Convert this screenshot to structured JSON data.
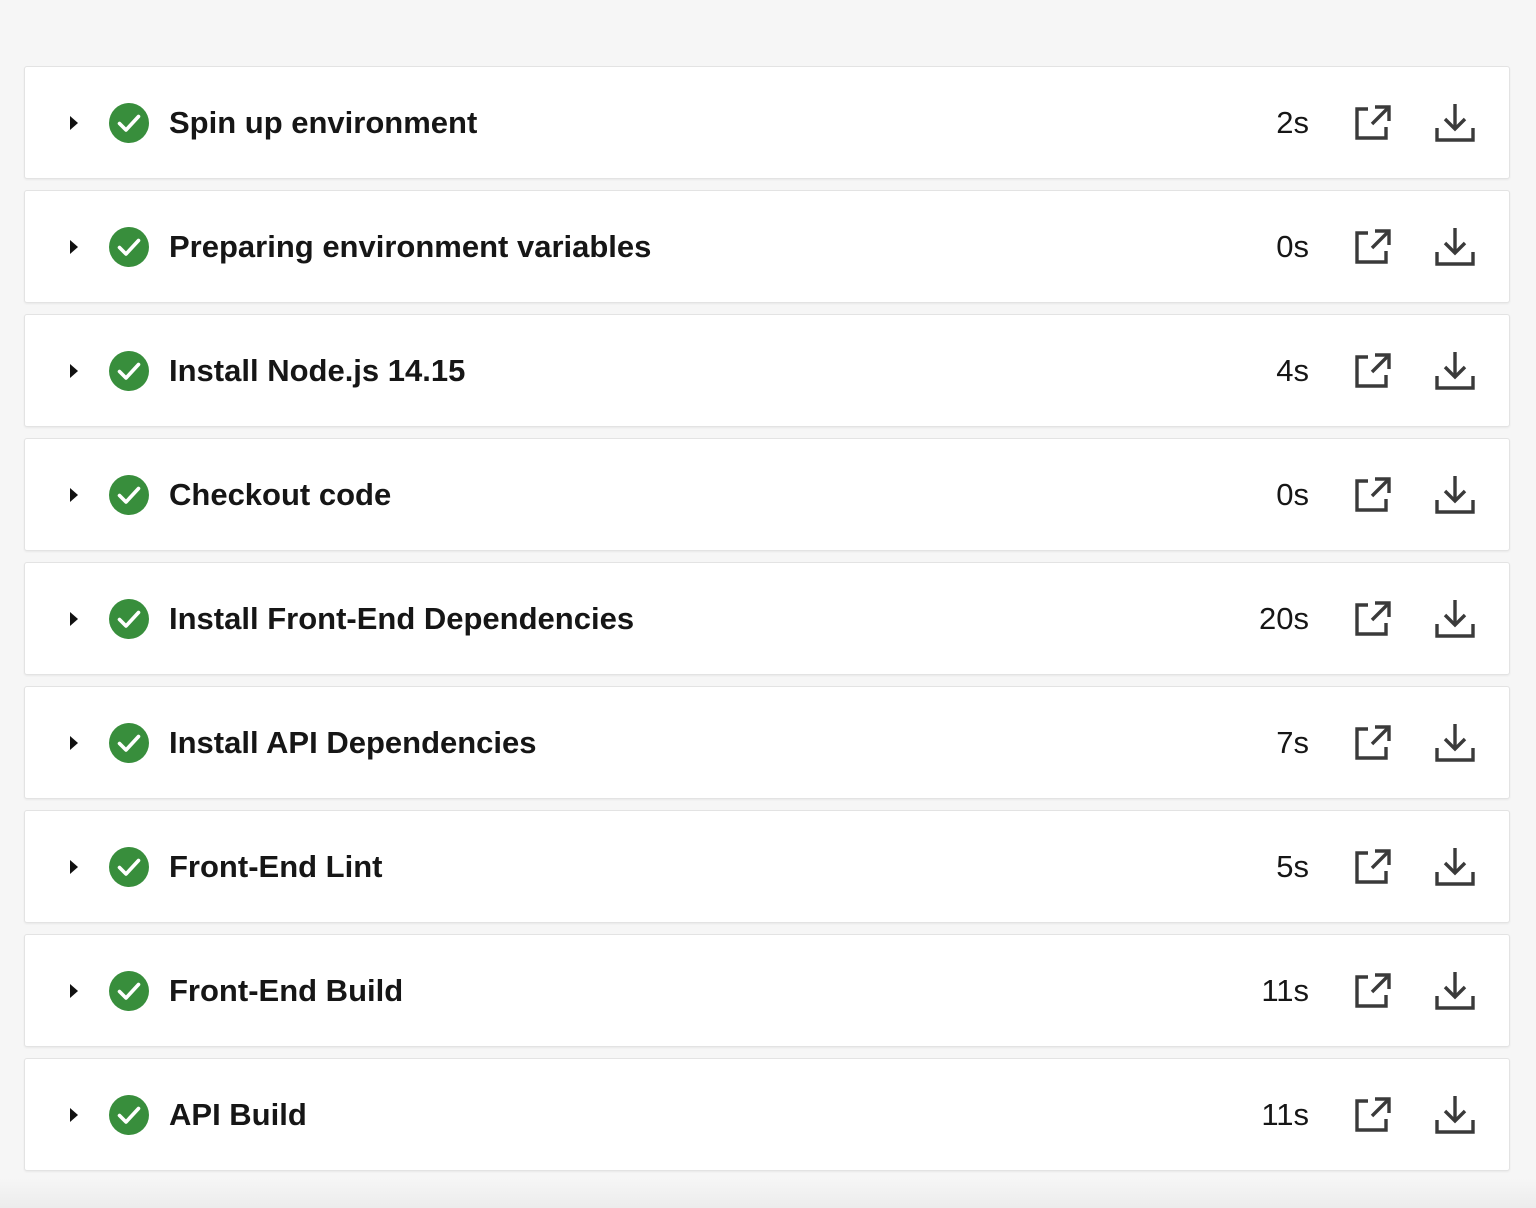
{
  "colors": {
    "success": "#388e3c",
    "text": "#161616",
    "icon": "#3a3a3a",
    "card_border": "#e3e3e3",
    "background": "#f6f6f6"
  },
  "icons": {
    "expand": "caret-right-icon",
    "status": "success-check-icon",
    "open": "external-link-icon",
    "download": "download-icon"
  },
  "steps": [
    {
      "name": "Spin up environment",
      "duration": "2s"
    },
    {
      "name": "Preparing environment variables",
      "duration": "0s"
    },
    {
      "name": "Install Node.js 14.15",
      "duration": "4s"
    },
    {
      "name": "Checkout code",
      "duration": "0s"
    },
    {
      "name": "Install Front-End Dependencies",
      "duration": "20s"
    },
    {
      "name": "Install API Dependencies",
      "duration": "7s"
    },
    {
      "name": "Front-End Lint",
      "duration": "5s"
    },
    {
      "name": "Front-End Build",
      "duration": "11s"
    },
    {
      "name": "API Build",
      "duration": "11s"
    }
  ]
}
